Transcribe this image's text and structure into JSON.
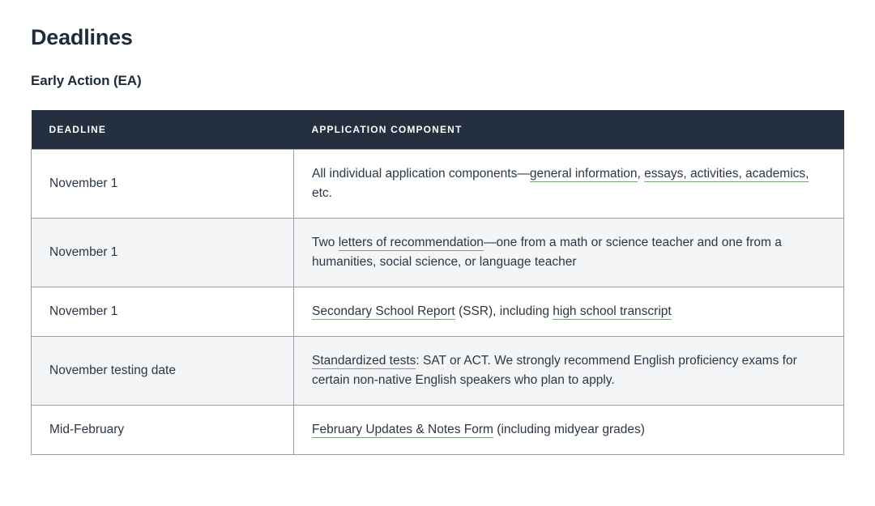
{
  "page": {
    "title": "Deadlines",
    "section_subtitle": "Early Action (EA)",
    "background": "#ffffff",
    "header_bg": "#24303f",
    "header_text": "#ffffff",
    "body_text": "#2b3744",
    "link_underline": "#7aa37a",
    "row_shaded_bg": "#f4f5f6",
    "border_color": "#9a9fa5"
  },
  "table": {
    "columns": [
      {
        "key": "deadline",
        "label": "DEADLINE"
      },
      {
        "key": "component",
        "label": "APPLICATION COMPONENT"
      }
    ],
    "rows": [
      {
        "deadline": "November 1",
        "component_plain": "All individual application components—general information, essays, activities, academics, etc.",
        "segments": [
          {
            "text": "All individual application components—",
            "link": false
          },
          {
            "text": "general information",
            "link": true
          },
          {
            "text": ", ",
            "link": false
          },
          {
            "text": "essays, activities, academics,",
            "link": true
          },
          {
            "text": " etc.",
            "link": false
          }
        ]
      },
      {
        "deadline": "November 1",
        "component_plain": "Two letters of recommendation—one from a math or science teacher and one from a humanities, social science, or language teacher",
        "segments": [
          {
            "text": "Two ",
            "link": false
          },
          {
            "text": "letters of recommendation",
            "link": true
          },
          {
            "text": "—one from a math or science teacher and one from a humanities, social science, or language teacher",
            "link": false
          }
        ]
      },
      {
        "deadline": "November 1",
        "component_plain": "Secondary School Report (SSR), including high school transcript",
        "segments": [
          {
            "text": "Secondary School Report",
            "link": true
          },
          {
            "text": " (SSR), including ",
            "link": false
          },
          {
            "text": "high school transcript",
            "link": true
          }
        ]
      },
      {
        "deadline": "November testing date",
        "component_plain": "Standardized tests: SAT or ACT. We strongly recommend English proficiency exams for certain non-native English speakers who plan to apply.",
        "segments": [
          {
            "text": "Standardized tests",
            "link": true
          },
          {
            "text": ": SAT or ACT. We strongly recommend English proficiency exams for certain non-native English speakers who plan to apply.",
            "link": false
          }
        ]
      },
      {
        "deadline": "Mid-February",
        "component_plain": "February Updates & Notes Form (including midyear grades)",
        "segments": [
          {
            "text": "February Updates & Notes Form",
            "link": true
          },
          {
            "text": " (including midyear grades)",
            "link": false
          }
        ]
      }
    ]
  }
}
